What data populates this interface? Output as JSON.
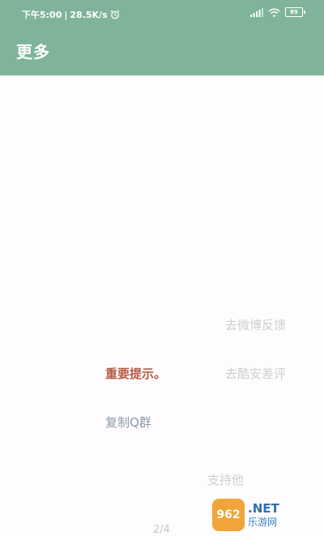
{
  "status_bar": {
    "time": "下午5:00",
    "speed": "28.5K/s",
    "battery": "89"
  },
  "header": {
    "title": "更多"
  },
  "links": {
    "weibo_feedback": "去微博反馈",
    "coolapk_review": "去酷安差评",
    "important_notice": "重要提示。",
    "copy_qq_group": "复制Q群",
    "support": "支持他"
  },
  "pager": "2/4",
  "watermark": {
    "logo": "962",
    "net": ".NET",
    "cn": "乐游网"
  },
  "colors": {
    "header_bg": "#80b49a",
    "warning": "#b55a45"
  }
}
